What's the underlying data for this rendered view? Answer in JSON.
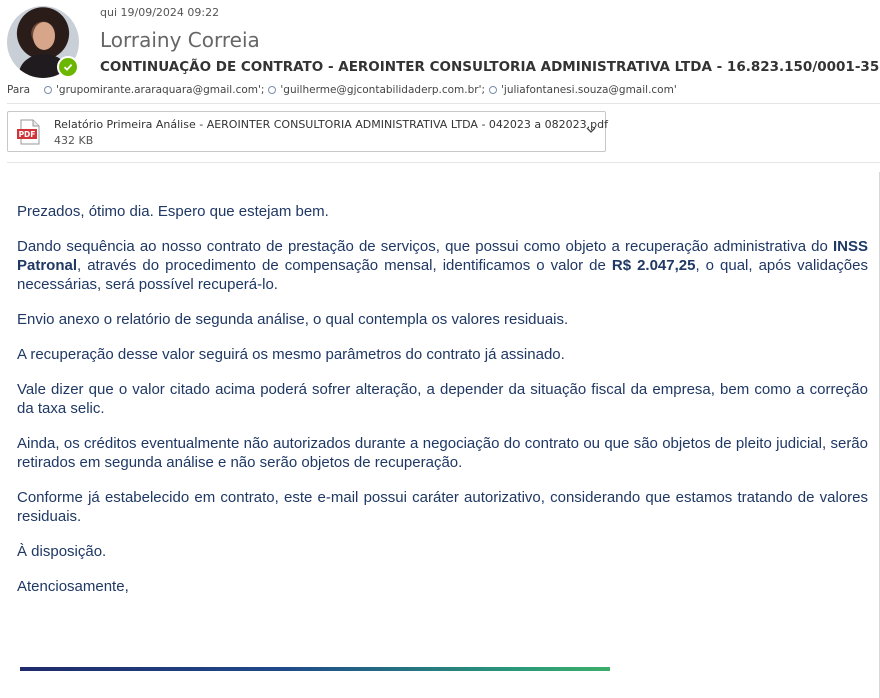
{
  "header": {
    "date": "qui 19/09/2024 09:22",
    "sender": "Lorrainy Correia",
    "subject": "CONTINUAÇÃO DE CONTRATO - AEROINTER CONSULTORIA ADMINISTRATIVA LTDA  - 16.823.150/0001-35",
    "to_label": "Para",
    "recipients": [
      "'grupomirante.araraquara@gmail.com';",
      "'guilherme@gjcontabilidaderp.com.br';",
      "'juliafontanesi.souza@gmail.com'"
    ],
    "presence_color": "#6bb700"
  },
  "attachment": {
    "icon": "pdf-icon",
    "badge": "PDF",
    "name": "Relatório Primeira Análise - AEROINTER CONSULTORIA ADMINISTRATIVA LTDA - 042023 a 082023.pdf",
    "size": "432 KB"
  },
  "body": {
    "greeting": "Prezados, ótimo dia. Espero que estejam bem.",
    "p2_a": "Dando sequência ao nosso contrato de prestação de serviços, que possui como objeto a recuperação administrativa do ",
    "p2_b1": "INSS Patronal",
    "p2_c": ", através do procedimento de compensação mensal, identificamos o valor de ",
    "p2_b2": "R$ 2.047,25",
    "p2_d": ", o qual, após validações necessárias, será possível recuperá-lo.",
    "p3": "Envio anexo o relatório de segunda análise, o qual contempla os valores residuais.",
    "p4": "A recuperação desse valor seguirá os mesmo parâmetros do contrato já assinado.",
    "p5": "Vale dizer que o valor citado acima poderá sofrer alteração, a depender da situação fiscal da empresa, bem como a correção da taxa selic.",
    "p6": "Ainda, os créditos eventualmente não autorizados durante a negociação do contrato ou que são objetos de pleito judicial, serão retirados em segunda análise e não serão objetos de recuperação.",
    "p7": "Conforme já estabelecido em contrato, este e-mail possui caráter autorizativo, considerando que estamos tratando de valores residuais.",
    "p8": "À disposição.",
    "p9": "Atenciosamente,",
    "text_color": "#1f3864"
  }
}
